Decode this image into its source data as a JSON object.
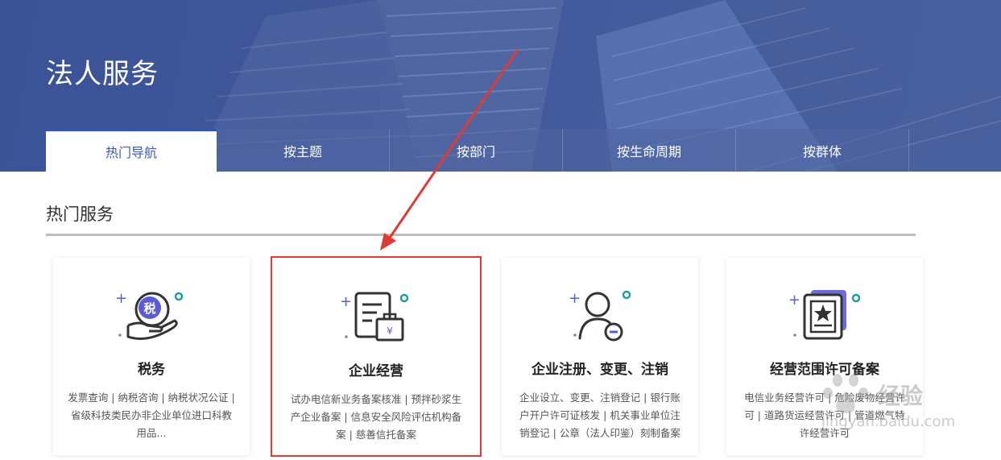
{
  "page": {
    "title": "法人服务"
  },
  "tabs": [
    {
      "label": "热门导航",
      "active": true
    },
    {
      "label": "按主题",
      "active": false
    },
    {
      "label": "按部门",
      "active": false
    },
    {
      "label": "按生命周期",
      "active": false
    },
    {
      "label": "按群体",
      "active": false
    }
  ],
  "section": {
    "title": "热门服务"
  },
  "cards": [
    {
      "title": "税务",
      "icon": "tax-hand-icon",
      "icon_text": "税",
      "description": "发票查询 |  纳税咨询 |  纳税状况公证 |  省级科技类民办非企业单位进口科教用品..."
    },
    {
      "title": "企业经营",
      "icon": "document-briefcase-icon",
      "icon_text": "¥",
      "description": "试办电信新业务备案核准 |  预拌砂浆生产企业备案 |  信息安全风险评估机构备案 |  慈善信托备案",
      "highlighted": true
    },
    {
      "title": "企业注册、变更、注销",
      "icon": "user-minus-icon",
      "description": "企业设立、变更、注销登记 |  银行账户开户许可证核发 |  机关事业单位注销登记 |  公章（法人印鉴）刻制备案"
    },
    {
      "title": "经营范围许可备案",
      "icon": "certificate-star-icon",
      "description": "电信业务经营许可 |  危险废物经营许可 |  道路货运经营许可 |  管道燃气特许经营许可"
    }
  ],
  "watermark": {
    "text": "经验",
    "url": "jingyan.baidu.com"
  },
  "colors": {
    "banner": "#41599b",
    "accent": "#2e55c7",
    "icon_purple": "#5b5bd6",
    "icon_teal": "#1aa39a",
    "annotation_red": "#e03a34"
  }
}
